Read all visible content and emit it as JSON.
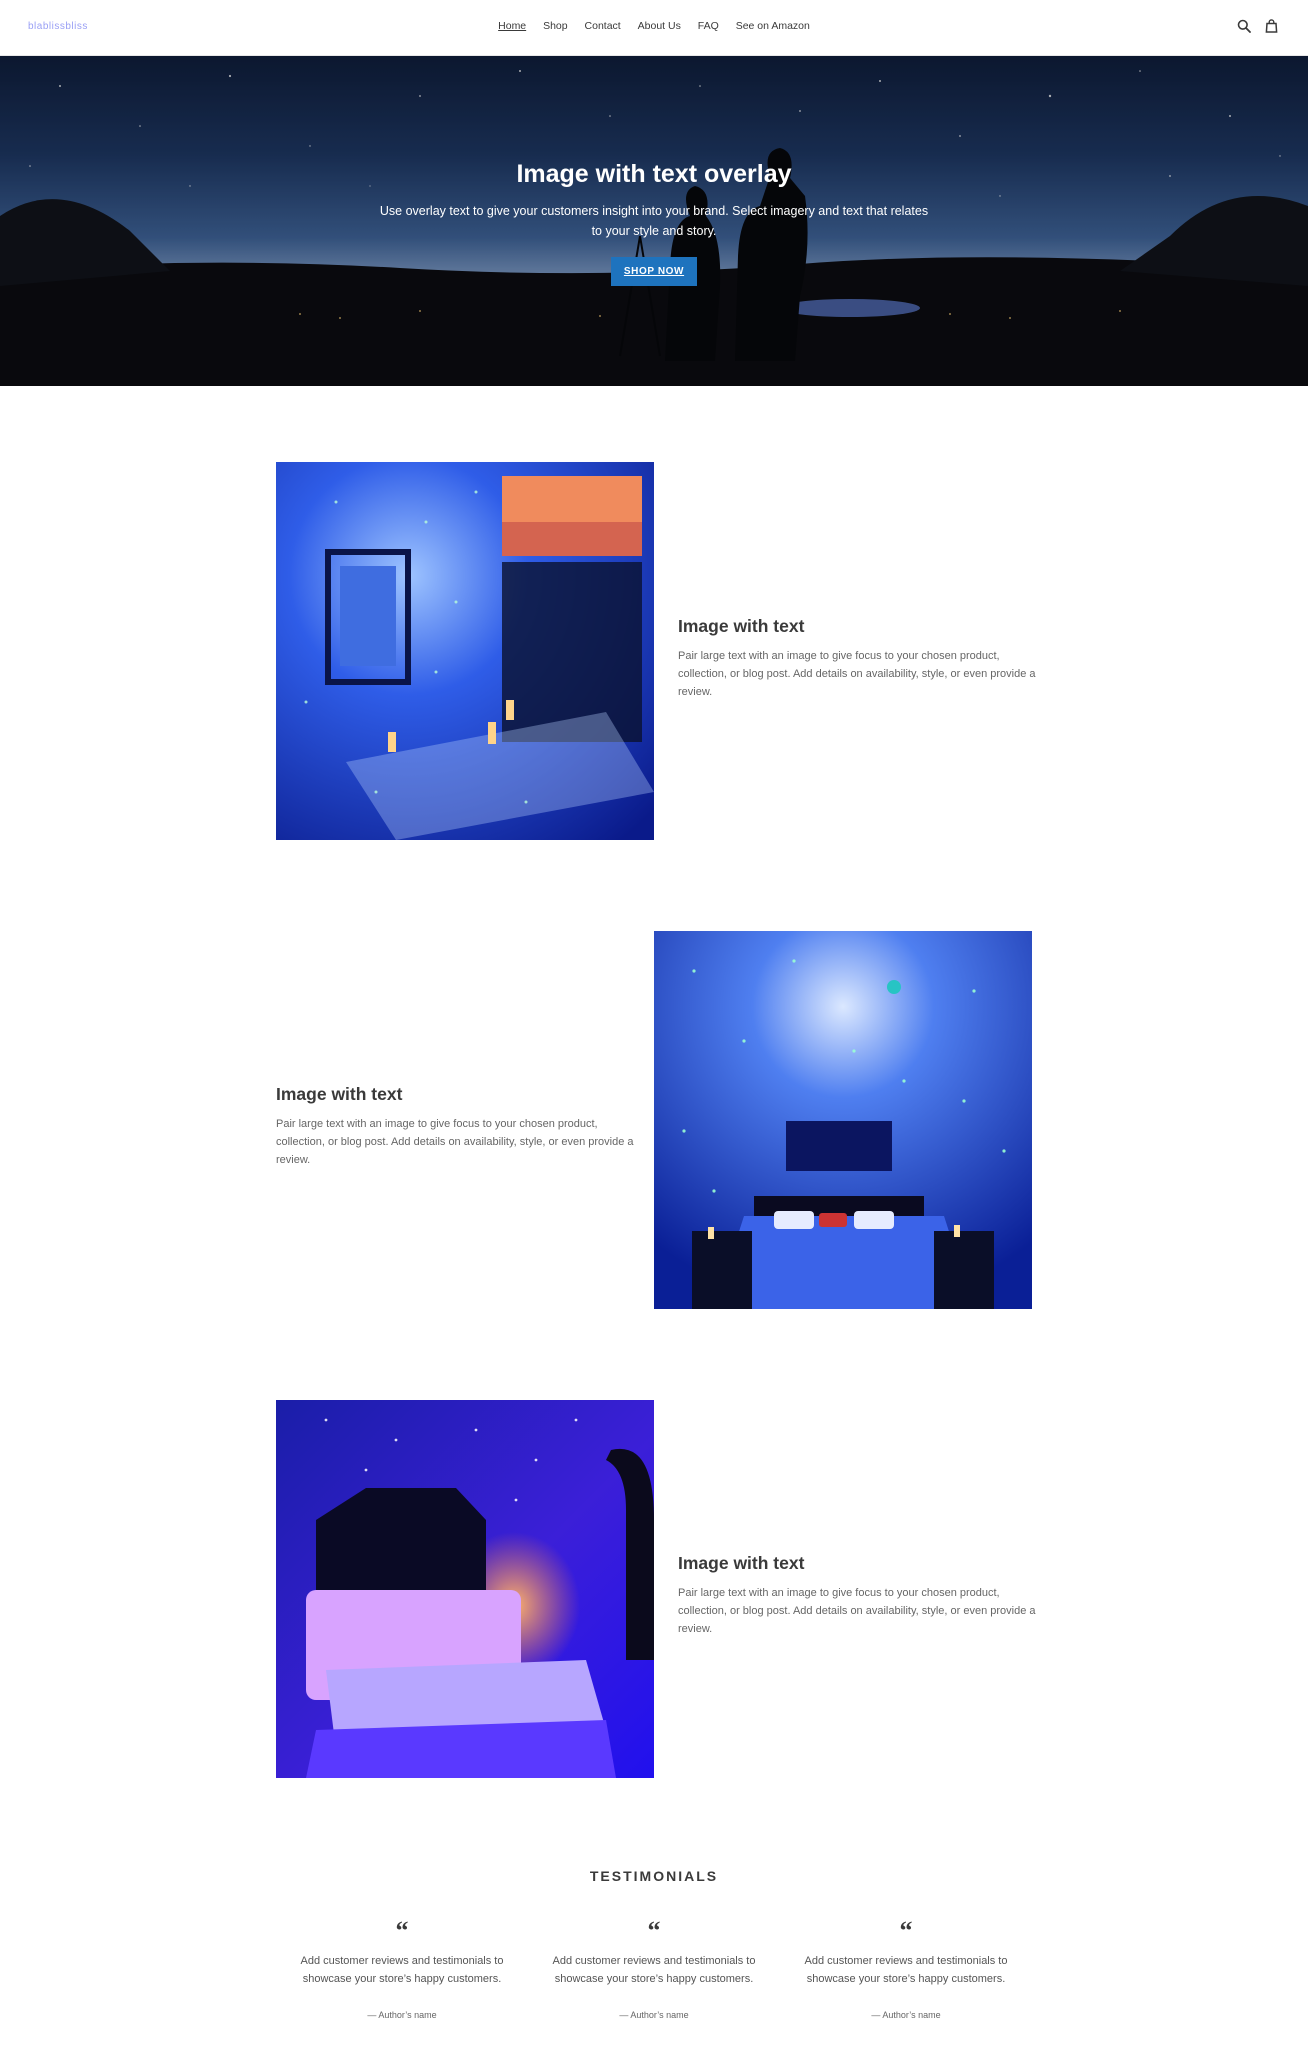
{
  "header": {
    "logo": "blablissbliss",
    "nav": [
      {
        "label": "Home"
      },
      {
        "label": "Shop"
      },
      {
        "label": "Contact"
      },
      {
        "label": "About Us"
      },
      {
        "label": "FAQ"
      },
      {
        "label": "See on Amazon"
      }
    ],
    "search_icon": "search-icon",
    "cart_icon": "cart-icon"
  },
  "hero": {
    "title": "Image with text overlay",
    "text": "Use overlay text to give your customers insight into your brand. Select imagery and text that relates to your style and story.",
    "button": "SHOP NOW"
  },
  "features": [
    {
      "title": "Image with text",
      "body": "Pair large text with an image to give focus to your chosen product, collection, or blog post. Add details on availability, style, or even provide a review."
    },
    {
      "title": "Image with text",
      "body": "Pair large text with an image to give focus to your chosen product, collection, or blog post. Add details on availability, style, or even provide a review."
    },
    {
      "title": "Image with text",
      "body": "Pair large text with an image to give focus to your chosen product, collection, or blog post. Add details on availability, style, or even provide a review."
    }
  ],
  "testimonials": {
    "heading": "TESTIMONIALS",
    "items": [
      {
        "quote": "“",
        "body": "Add customer reviews and testimonials to showcase your store’s happy customers.",
        "author": "— Author’s name"
      },
      {
        "quote": "“",
        "body": "Add customer reviews and testimonials to showcase your store’s happy customers.",
        "author": "— Author’s name"
      },
      {
        "quote": "“",
        "body": "Add customer reviews and testimonials to showcase your store’s happy customers.",
        "author": "— Author’s name"
      }
    ]
  },
  "colors": {
    "accent": "#1e73be",
    "text": "#3a3a3a"
  }
}
